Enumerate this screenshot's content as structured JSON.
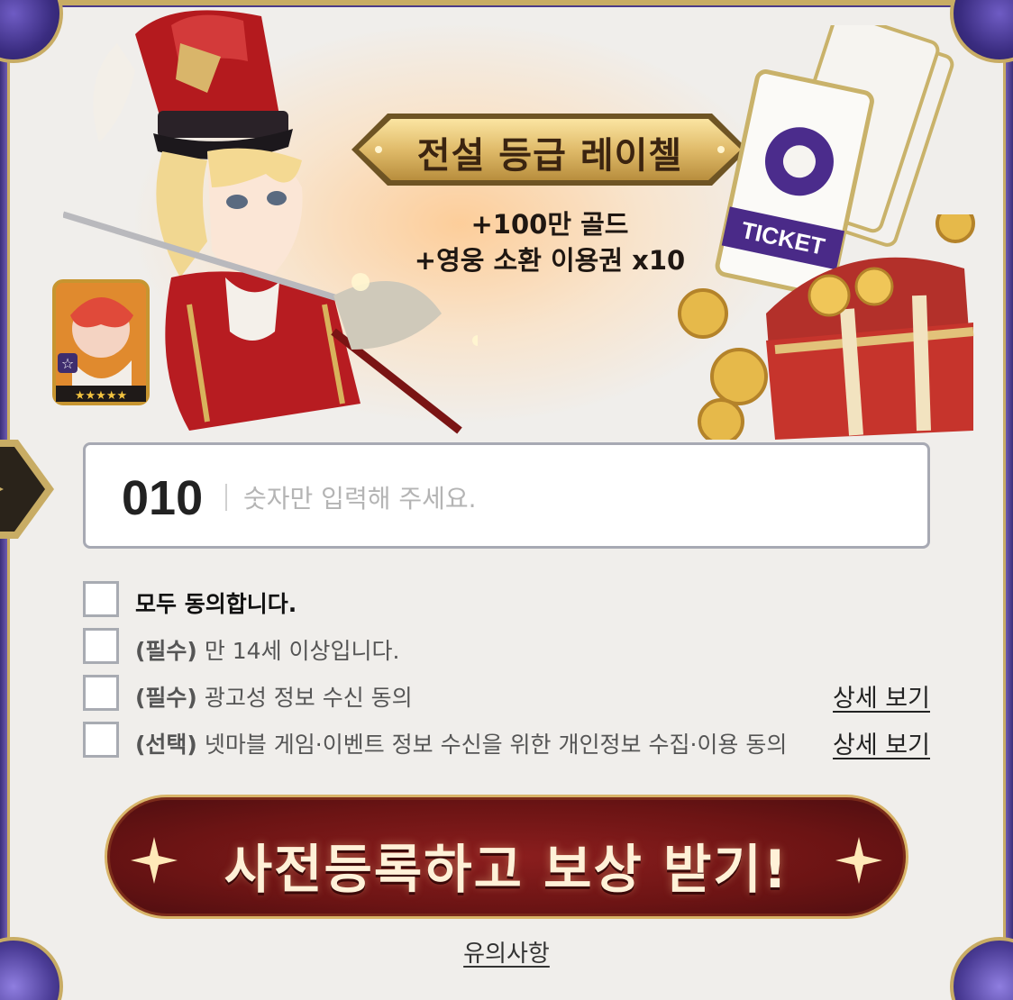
{
  "promo": {
    "badge_title": "전설 등급 레이첼",
    "reward_gold": "+100만 골드",
    "reward_tickets": "+영웅 소환 이용권 x10",
    "ticket_label": "TICKET"
  },
  "phone": {
    "prefix": "010",
    "placeholder": "숫자만 입력해 주세요."
  },
  "agreements": {
    "all": "모두 동의합니다.",
    "items": [
      {
        "tag": "(필수)",
        "text": "만 14세 이상입니다.",
        "link": ""
      },
      {
        "tag": "(필수)",
        "text": "광고성 정보 수신 동의",
        "link": "상세 보기"
      },
      {
        "tag": "(선택)",
        "text": "넷마블 게임·이벤트 정보 수신을 위한 개인정보 수집·이용 동의",
        "link": "상세 보기"
      }
    ]
  },
  "cta": {
    "label": "사전등록하고 보상 받기!"
  },
  "notice": {
    "label": "유의사항"
  },
  "colors": {
    "background": "#f0eeeb",
    "frame_purple": "#3b2f7a",
    "frame_gold": "#c8ac64",
    "cta_red": "#6c1414",
    "input_border": "#a7a9b3"
  }
}
